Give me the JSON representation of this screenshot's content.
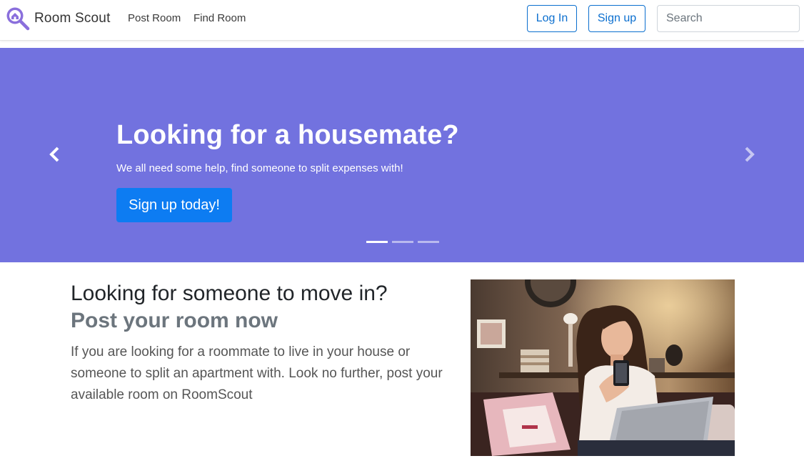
{
  "navbar": {
    "brand_name": "Room Scout",
    "brand_icon": "house-magnifier-icon",
    "links": [
      {
        "label": "Post Room"
      },
      {
        "label": "Find Room"
      }
    ],
    "login_label": "Log In",
    "signup_label": "Sign up",
    "search_placeholder": "Search",
    "accent_color": "#0b6fcf"
  },
  "hero": {
    "title": "Looking for a housemate?",
    "subtitle": "We all need some help, find someone to split expenses with!",
    "cta_label": "Sign up today!",
    "background_color": "#7272df",
    "cta_color": "#0d7cf2",
    "prev_icon": "chevron-left-icon",
    "next_icon": "chevron-right-icon",
    "slide_count": 3,
    "active_slide": 1
  },
  "feature": {
    "heading": "Looking for someone to move in?",
    "subheading": "Post your room now",
    "body": "If you are looking for a roommate to live in your house or someone to split an apartment with. Look no further, post your available room on RoomScout",
    "photo": "woman-with-phone-and-laptop-photo"
  }
}
